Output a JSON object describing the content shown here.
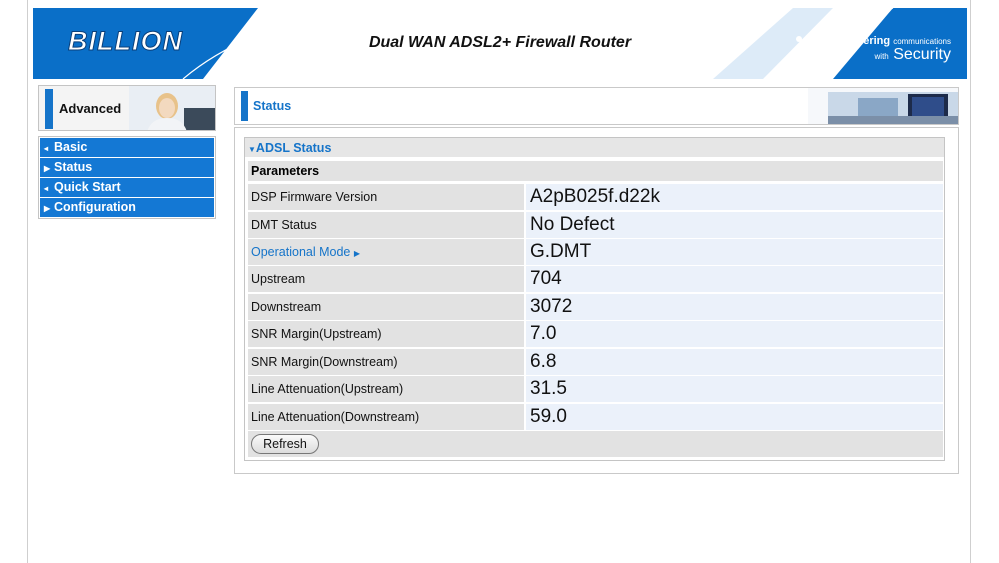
{
  "header": {
    "logo": "BILLION",
    "router_title": "Dual WAN ADSL2+ Firewall Router",
    "tagline_powering": "Powering",
    "tagline_communications": "communications",
    "tagline_with": "with",
    "tagline_security": "Security",
    "brand_color": "#0a6fc8"
  },
  "sidebar": {
    "advanced_label": "Advanced",
    "items": [
      {
        "label": "Basic",
        "icon": "small-arrow-icon"
      },
      {
        "label": "Status",
        "icon": "triangle-right-icon"
      },
      {
        "label": "Quick Start",
        "icon": "small-arrow-icon"
      },
      {
        "label": "Configuration",
        "icon": "triangle-right-icon"
      }
    ]
  },
  "content": {
    "page_title": "Status",
    "section_title": "ADSL Status",
    "params_header": "Parameters",
    "rows": [
      {
        "label": "DSP Firmware Version",
        "value": "A2pB025f.d22k"
      },
      {
        "label": "DMT Status",
        "value": "No Defect"
      },
      {
        "label": "Operational Mode",
        "value": "G.DMT"
      },
      {
        "label": "Upstream",
        "value": "704"
      },
      {
        "label": "Downstream",
        "value": "3072"
      },
      {
        "label": "SNR Margin(Upstream)",
        "value": "7.0"
      },
      {
        "label": "SNR Margin(Downstream)",
        "value": "6.8"
      },
      {
        "label": "Line Attenuation(Upstream)",
        "value": "31.5"
      },
      {
        "label": "Line Attenuation(Downstream)",
        "value": "59.0"
      }
    ],
    "refresh_label": "Refresh",
    "accent_color": "#1574c9"
  }
}
